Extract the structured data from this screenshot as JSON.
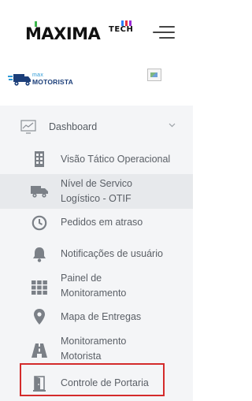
{
  "header": {
    "logo_main": "MAXIMA",
    "logo_suffix": "TECH",
    "logo_tick_colors": [
      "#3bb54a",
      "#2d7ff9",
      "#e6333f",
      "#9b2cd6"
    ],
    "menu_icon": "hamburger-icon"
  },
  "brand": {
    "prefix": "max",
    "name": "MOTORISTA",
    "icon": "truck-icon",
    "colors": {
      "prefix": "#2e9ad7",
      "name": "#1c3f7a"
    }
  },
  "nav": {
    "dashboard": {
      "label": "Dashboard",
      "icon": "chart-icon",
      "chevron": "chevron-down-icon"
    },
    "items": [
      {
        "label_lines": [
          "Visão Tático Operacional"
        ],
        "icon": "building-icon"
      },
      {
        "label_lines": [
          "Nível de Servico",
          "Logístico - OTIF"
        ],
        "icon": "truck-icon",
        "active": true
      },
      {
        "label_lines": [
          "Pedidos em atraso"
        ],
        "icon": "clock-icon"
      },
      {
        "label_lines": [
          "Notificações de usuário"
        ],
        "icon": "bell-icon"
      },
      {
        "label_lines": [
          "Painel de",
          "Monitoramento"
        ],
        "icon": "grid-icon"
      },
      {
        "label_lines": [
          "Mapa de Entregas"
        ],
        "icon": "map-pin-icon"
      },
      {
        "label_lines": [
          "Monitoramento",
          "Motorista"
        ],
        "icon": "road-icon"
      },
      {
        "label_lines": [
          "Controle de Portaria"
        ],
        "icon": "door-icon",
        "highlighted": true
      }
    ]
  },
  "colors": {
    "icon": "#7b8087",
    "text": "#5a5f66",
    "nav_background": "#f4f5f7",
    "highlight_border": "#d42b2b"
  }
}
